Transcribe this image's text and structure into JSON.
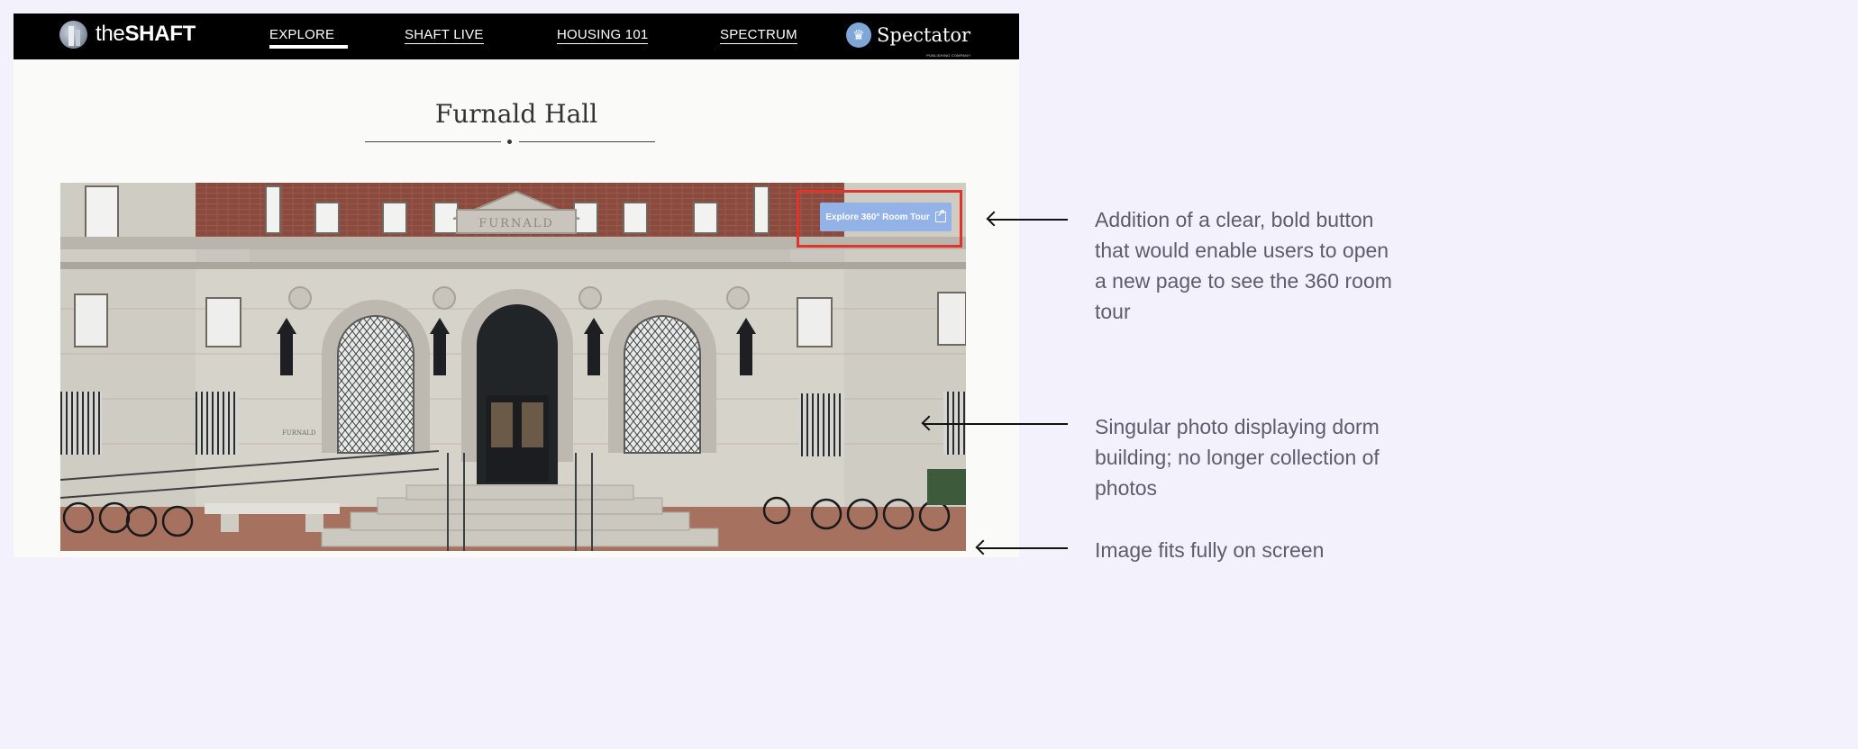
{
  "nav": {
    "logo_prefix": "the",
    "logo_bold": "SHAFT",
    "links": [
      "EXPLORE",
      "SHAFT LIVE",
      "HOUSING 101",
      "SPECTRUM"
    ],
    "active_index": 0,
    "brand": "Spectator",
    "brand_sub": "PUBLISHING COMPANY"
  },
  "page": {
    "title": "Furnald Hall",
    "building_inscription": "FURNALD",
    "plaque": "FURNALD"
  },
  "room_tour_button": {
    "label": "Explore 360° Room Tour",
    "icon": "external-link-icon"
  },
  "annotations": [
    "Addition of a clear, bold button that would enable users to open a new page to see the 360 room tour",
    "Singular photo displaying dorm building; no longer collection of photos",
    "Image fits fully on screen"
  ],
  "colors": {
    "nav_bg": "#000000",
    "button_bg": "#93b2e8",
    "highlight": "#e2332b",
    "annotation_text": "#5f5c6b",
    "canvas_bg": "#f3f1fb"
  }
}
